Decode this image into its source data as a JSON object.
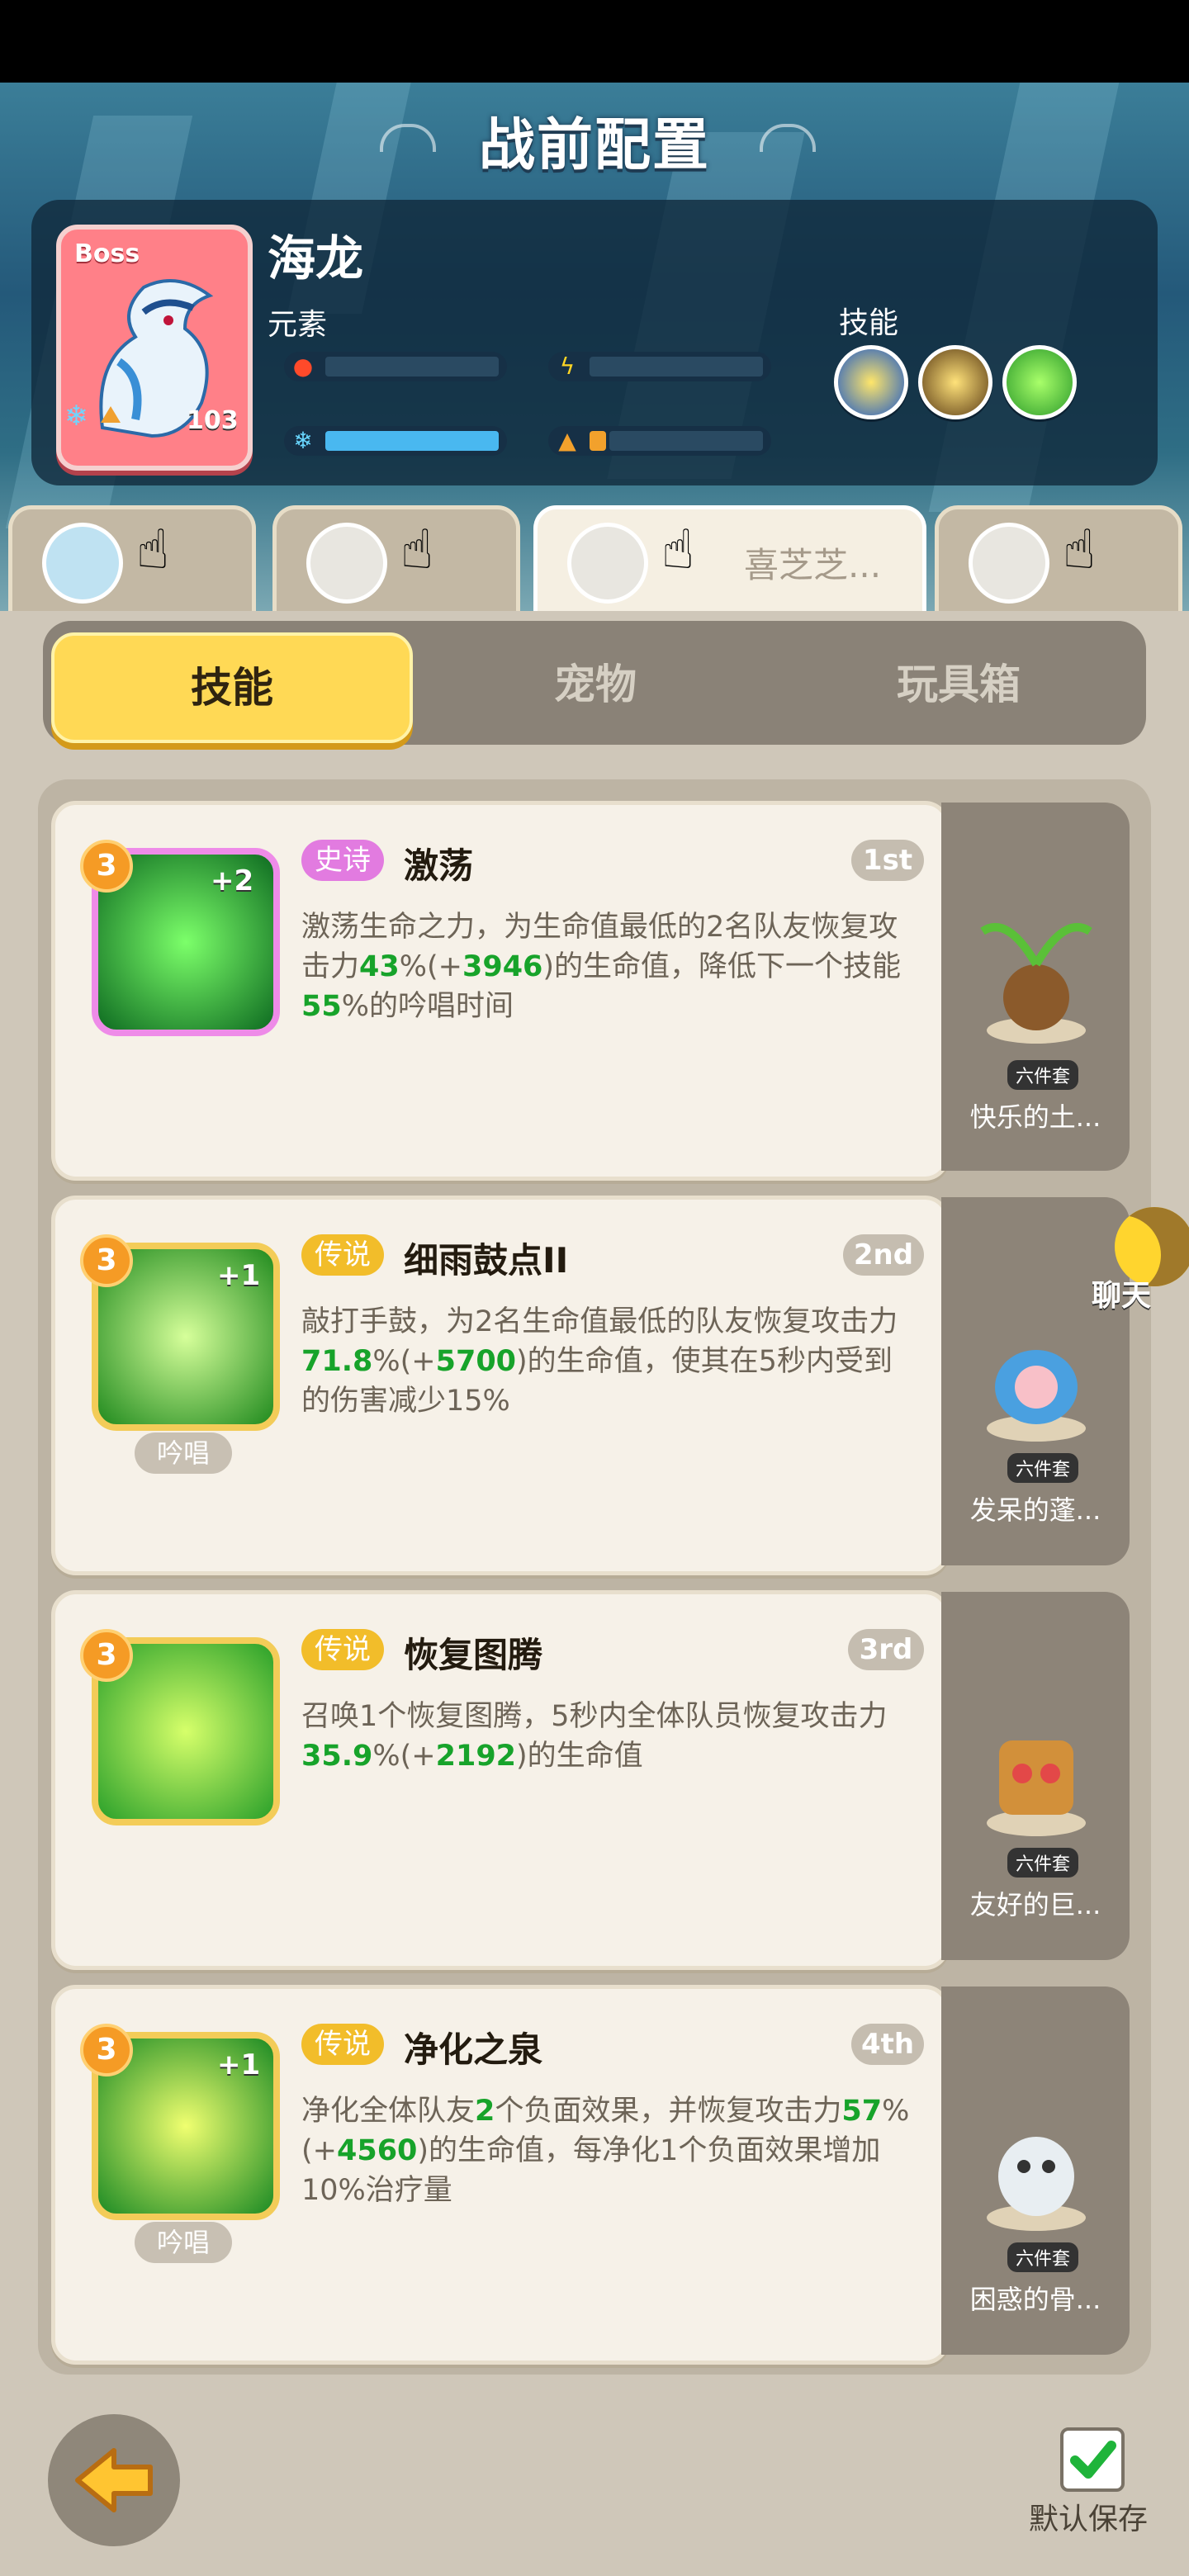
{
  "header": {
    "title": "战前配置",
    "boss_label": "Boss",
    "boss_name": "海龙",
    "boss_level": "103",
    "element_label": "元素",
    "skill_label": "技能"
  },
  "hero_tabs": [
    {
      "name": ""
    },
    {
      "name": ""
    },
    {
      "name": "喜芝芝..."
    },
    {
      "name": ""
    }
  ],
  "segments": {
    "skills": "技能",
    "pets": "宠物",
    "toybox": "玩具箱"
  },
  "skills": [
    {
      "level": "3",
      "plus": "+2",
      "rarity": "史诗",
      "name": "激荡",
      "rank": "1st",
      "desc": [
        "激荡生命之力，为生命值最低的2名队友恢复攻击力",
        "43",
        "%(+",
        "3946",
        ")的生命值，降低下一个技能",
        "55",
        "%的吟唱时间"
      ],
      "chant": ""
    },
    {
      "level": "3",
      "plus": "+1",
      "rarity": "传说",
      "name": "细雨鼓点II",
      "rank": "2nd",
      "desc": [
        "敲打手鼓，为2名生命值最低的队友恢复攻击力",
        "71.8",
        "%(+",
        "5700",
        ")的生命值，使其在5秒内受到的伤害减少15%",
        "",
        ""
      ],
      "chant": "吟唱"
    },
    {
      "level": "3",
      "plus": "",
      "rarity": "传说",
      "name": "恢复图腾",
      "rank": "3rd",
      "desc": [
        "召唤1个恢复图腾，5秒内全体队员恢复攻击力",
        "35.9",
        "%(+",
        "2192",
        ")的生命值",
        "",
        ""
      ],
      "chant": ""
    },
    {
      "level": "3",
      "plus": "+1",
      "rarity": "传说",
      "name": "净化之泉",
      "rank": "4th",
      "desc": [
        "净化全体队友",
        "2",
        "个负面效果，并恢复攻击力",
        "57",
        "%(+",
        "4560",
        ")的生命值，每净化1个负面效果增加10%治疗量"
      ],
      "chant": "吟唱"
    }
  ],
  "pets": [
    {
      "badge": "六件套",
      "name": "快乐的土..."
    },
    {
      "badge": "六件套",
      "name": "发呆的蓬..."
    },
    {
      "badge": "六件套",
      "name": "友好的巨..."
    },
    {
      "badge": "六件套",
      "name": "困惑的骨..."
    }
  ],
  "chat_label": "聊天",
  "save_label": "默认保存",
  "colors": {
    "epic": "#e27be0",
    "legend": "#f2bd2a",
    "highlight_green": "#17a32a",
    "tab_active": "#ffd955"
  }
}
